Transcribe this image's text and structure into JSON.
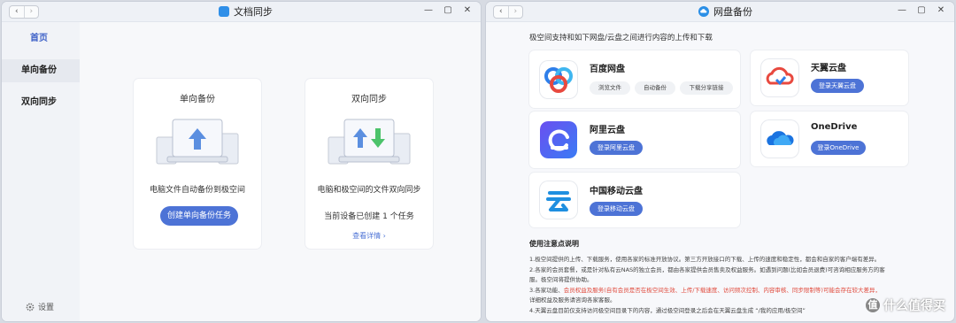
{
  "left_window": {
    "title": "文档同步",
    "nav_back": "‹",
    "nav_forward": "›",
    "controls": [
      "—",
      "▢",
      "✕"
    ],
    "sidebar": {
      "items": [
        {
          "label": "首页"
        },
        {
          "label": "单向备份"
        },
        {
          "label": "双向同步"
        }
      ],
      "settings_label": "设置"
    },
    "cards": [
      {
        "title": "单向备份",
        "description": "电脑文件自动备份到极空间",
        "button": "创建单向备份任务"
      },
      {
        "title": "双向同步",
        "description": "电脑和极空间的文件双向同步",
        "count_text": "当前设备已创建 1 个任务",
        "link": "查看详情 ›"
      }
    ]
  },
  "right_window": {
    "title": "网盘备份",
    "nav_back": "‹",
    "nav_forward": "›",
    "controls": [
      "—",
      "▢",
      "✕"
    ],
    "intro": "极空间支持和如下网盘/云盘之间进行内容的上传和下载",
    "services": {
      "baidu": {
        "name": "百度网盘",
        "chips": [
          "浏览文件",
          "自动备份",
          "下载分享链接"
        ]
      },
      "tianyi": {
        "name": "天翼云盘",
        "button": "登录天翼云盘"
      },
      "aliyun": {
        "name": "阿里云盘",
        "button": "登录阿里云盘"
      },
      "onedrive": {
        "name": "OneDrive",
        "button": "登录OneDrive"
      },
      "mobile": {
        "name": "中国移动云盘",
        "button": "登录移动云盘"
      }
    },
    "notes": {
      "title": "使用注意点说明",
      "lines": [
        "1.极空间提供的上传、下载服务，使用各家的标准开放协议。第三方开放接口的下载、上传的速度和稳定性，都会和自家的客户端有差异。",
        "2.各家的会员套餐，或是针对私有云NAS的独立会员，都由各家提供会员售卖及权益服务。如遇到问题(比如会员退费)可咨询相应服务方的客",
        "服。极空间将提供协助。",
        "3.各家功能、",
        "会员权益及服务(自有会员是否在极空间生效、上传/下载速度、访问频次控制、内容审核、同步限制等)可能会存在较大差异，",
        "详细权益及服务请咨询各家客服。",
        "4.天翼云盘目前仅支持访问极空间目录下的内容，通过极空间登录之后会在天翼云盘生成 “/我的应用/极空间”"
      ]
    },
    "watermark": "什么值得买",
    "watermark_icon": "值"
  },
  "colors": {
    "accent": "#4d73d6",
    "red_text": "#e04a3c"
  }
}
